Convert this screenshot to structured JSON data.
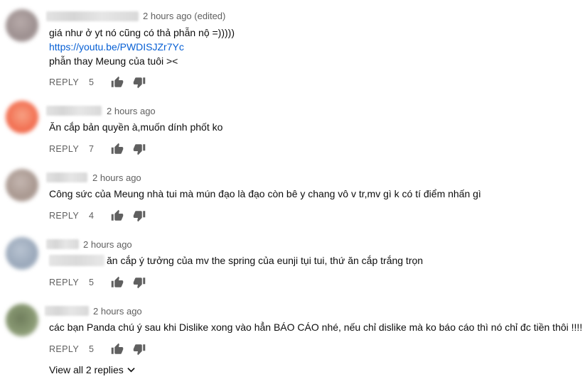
{
  "comments": [
    {
      "timestamp": "2 hours ago (edited)",
      "lines": [
        "giá như ở yt nó cũng có thả phẫn nộ =)))))",
        "https://youtu.be/PWDISJZr7Yc",
        "phẫn thay Meung của tuôi ><"
      ],
      "reply_label": "REPLY",
      "likes": "5",
      "avatar_color": "#a59a9a"
    },
    {
      "timestamp": "2 hours ago",
      "lines": [
        "Ăn cắp bản quyền à,muốn dính phốt ko"
      ],
      "reply_label": "REPLY",
      "likes": "7",
      "avatar_color": "#f27a5c"
    },
    {
      "timestamp": "2 hours ago",
      "lines": [
        "Công sức của Meung nhà tui mà mún đạo là đạo còn bê y chang  vô v tr,mv gì k có tí điểm nhấn gì"
      ],
      "reply_label": "REPLY",
      "likes": "4",
      "avatar_color": "#b3a59f"
    },
    {
      "timestamp": "2 hours ago",
      "lines": [
        "ăn cắp ý tưởng của mv the spring của eunji tụi tui, thứ ăn cắp trắng trọn"
      ],
      "reply_label": "REPLY",
      "likes": "5",
      "avatar_color": "#a7b3c4"
    },
    {
      "timestamp": "2 hours ago",
      "lines": [
        "các bạn Panda chú ý sau khi Dislike xong vào hẳn BÁO CÁO nhé, nếu chỉ dislike mà ko báo cáo thì nó chỉ đc tiền thôi !!!!"
      ],
      "reply_label": "REPLY",
      "likes": "5",
      "avatar_color": "#8b9a78"
    }
  ],
  "view_replies_label": "View all 2 replies",
  "icons": {
    "like": "thumbs-up-icon",
    "dislike": "thumbs-down-icon",
    "expand": "chevron-down-icon"
  },
  "colors": {
    "link": "#065fd4",
    "meta": "#606060",
    "text": "#0d0d0d",
    "icon": "#606060"
  }
}
